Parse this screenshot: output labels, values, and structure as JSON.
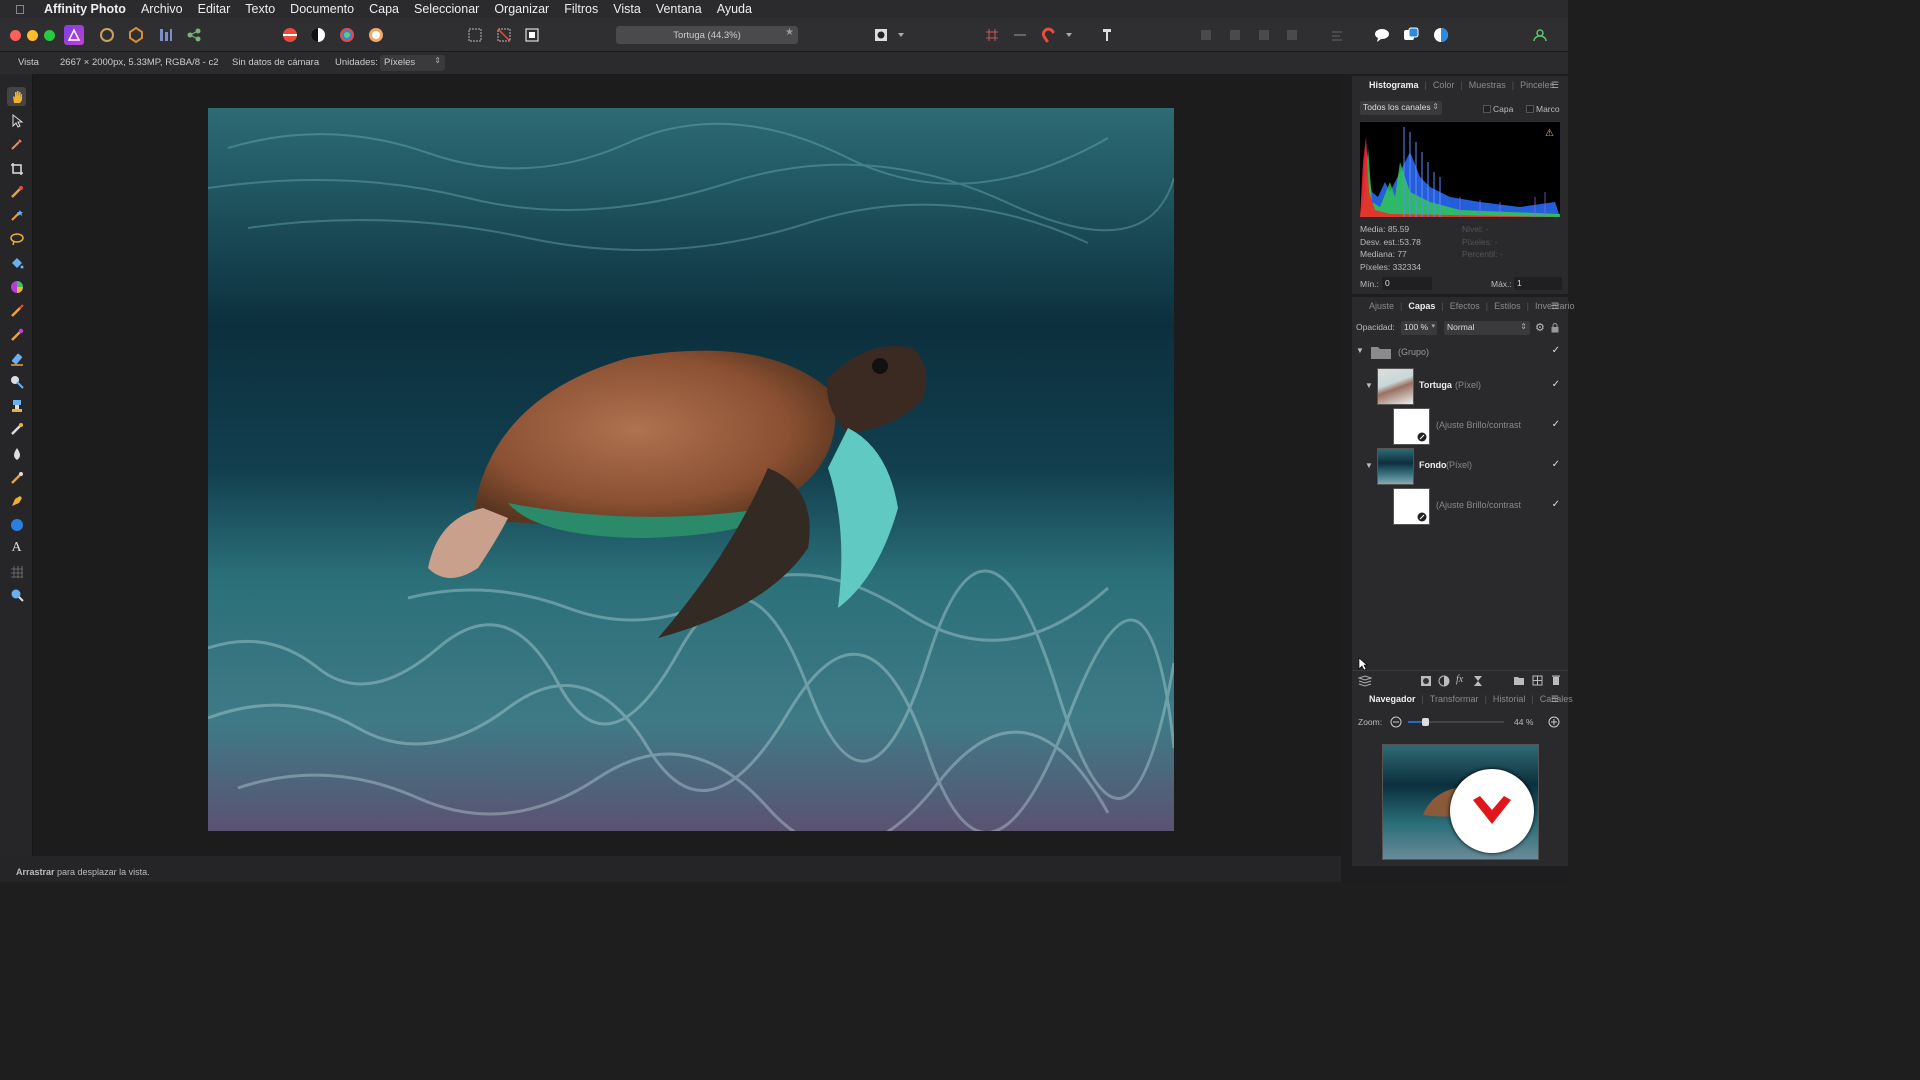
{
  "menubar": {
    "app": "Affinity Photo",
    "items": [
      "Archivo",
      "Editar",
      "Texto",
      "Documento",
      "Capa",
      "Seleccionar",
      "Organizar",
      "Filtros",
      "Vista",
      "Ventana",
      "Ayuda"
    ]
  },
  "toolbar": {
    "doc_title": "Tortuga (44.3%)",
    "star": "★"
  },
  "context": {
    "view": "Vista",
    "doc_info": "2667 × 2000px, 5.33MP, RGBA/8 - c2",
    "camera": "Sin datos de cámara",
    "units_label": "Unidades:",
    "units_value": "Píxeles"
  },
  "histogram": {
    "tabs": [
      "Histograma",
      "Color",
      "Muestras",
      "Pinceles"
    ],
    "channel": "Todos los canales",
    "opt_layer": "Capa",
    "opt_frame": "Marco",
    "stats": {
      "media": "Media: 85.59",
      "desv": "Desv. est.:53.78",
      "mediana": "Mediana: 77",
      "pixeles": "Píxeles: 332334",
      "nivel": "Nivel: -",
      "pixeles2": "Píxeles: -",
      "percentil": "Percentil: -"
    },
    "min_label": "Mín.:",
    "min_value": "0",
    "max_label": "Máx.:",
    "max_value": "1"
  },
  "layers": {
    "tabs": [
      "Ajuste",
      "Capas",
      "Efectos",
      "Estilos",
      "Inventario"
    ],
    "opacity_label": "Opacidad:",
    "opacity_value": "100 %",
    "blend": "Normal",
    "items": [
      {
        "name": "(Grupo)",
        "type": ""
      },
      {
        "name": "Tortuga",
        "type": "(Píxel)"
      },
      {
        "name": "(Ajuste Brillo/contrast",
        "type": ""
      },
      {
        "name": "Fondo",
        "type": "(Píxel)"
      },
      {
        "name": "(Ajuste Brillo/contrast",
        "type": ""
      }
    ]
  },
  "navigator": {
    "tabs": [
      "Navegador",
      "Transformar",
      "Historial",
      "Canales"
    ],
    "zoom_label": "Zoom:",
    "zoom_value": "44 %",
    "zoom_fraction": 0.44
  },
  "status": {
    "bold": "Arrastrar",
    "rest": " para desplazar la vista."
  },
  "colors": {
    "accent": "#1a6fd0",
    "menubar": "#2b2b2e",
    "brand_red": "#e0161b"
  }
}
